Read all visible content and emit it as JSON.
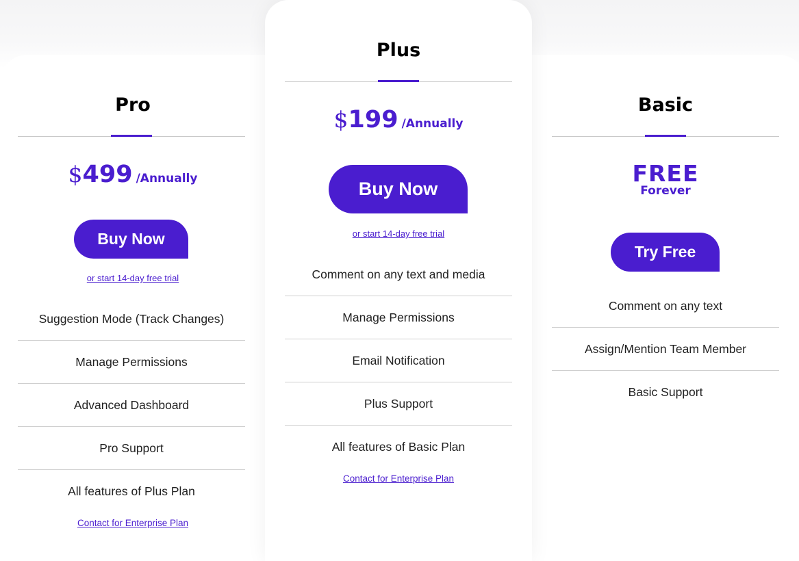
{
  "accent_color": "#4a1dcf",
  "plans": {
    "pro": {
      "title": "Pro",
      "currency": "$",
      "amount": "499",
      "period": "/Annually",
      "button_label": "Buy Now",
      "trial_link": "or start 14-day free trial",
      "features": [
        "Suggestion Mode (Track Changes)",
        "Manage Permissions",
        "Advanced Dashboard",
        "Pro Support",
        "All features of Plus Plan"
      ],
      "enterprise_link": "Contact for Enterprise Plan"
    },
    "plus": {
      "title": "Plus",
      "currency": "$",
      "amount": "199",
      "period": "/Annually",
      "button_label": "Buy Now",
      "trial_link": "or start 14-day free trial",
      "features": [
        "Comment on any text and media",
        "Manage Permissions",
        "Email Notification",
        "Plus Support",
        "All features of Basic Plan"
      ],
      "enterprise_link": "Contact for Enterprise Plan"
    },
    "basic": {
      "title": "Basic",
      "price_label": "FREE",
      "price_sub": "Forever",
      "button_label": "Try Free",
      "features": [
        "Comment on any text",
        "Assign/Mention Team Member",
        "Basic Support"
      ]
    }
  }
}
